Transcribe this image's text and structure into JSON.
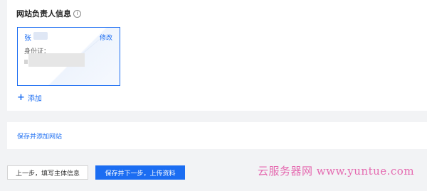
{
  "section": {
    "title": "网站负责人信息",
    "info_icon": "i"
  },
  "person_card": {
    "name": "张",
    "edit_label": "修改",
    "id_label": "身份证："
  },
  "add": {
    "icon": "+",
    "label": "添加"
  },
  "save_add": {
    "label": "保存并添加网站"
  },
  "footer": {
    "prev_label": "上一步，填写主体信息",
    "next_label": "保存并下一步，上传资料"
  },
  "watermark": {
    "text": "云服务器网 www.yuntue.com"
  },
  "colors": {
    "accent": "#1b6df2",
    "watermark": "#e56ab0",
    "background": "#f2f3f5"
  }
}
